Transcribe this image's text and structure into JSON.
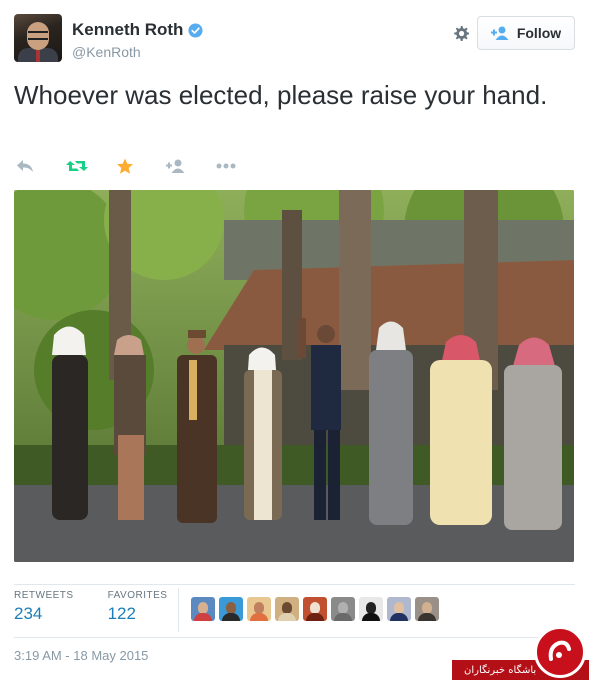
{
  "header": {
    "display_name": "Kenneth Roth",
    "handle": "@KenRoth",
    "follow_label": "Follow"
  },
  "tweet": {
    "text": "Whoever was elected, please raise your hand."
  },
  "actions": {
    "icons": [
      "reply-icon",
      "retweet-icon",
      "favorite-star-icon",
      "follow-icon",
      "more-icon"
    ],
    "colors": {
      "retweet": "#19cf86",
      "favorite": "#ffac33",
      "muted": "#aab8c2"
    }
  },
  "stats": {
    "retweets_label": "RETWEETS",
    "retweets_value": "234",
    "favorites_label": "FAVORITES",
    "favorites_value": "122"
  },
  "timestamp": "3:19 AM - 18 May 2015",
  "watermark": {
    "text": "باشگاه خبرنگاران"
  },
  "colors": {
    "link": "#1b7eb6",
    "verified": "#55acee",
    "watermark_red": "#c8101c"
  }
}
